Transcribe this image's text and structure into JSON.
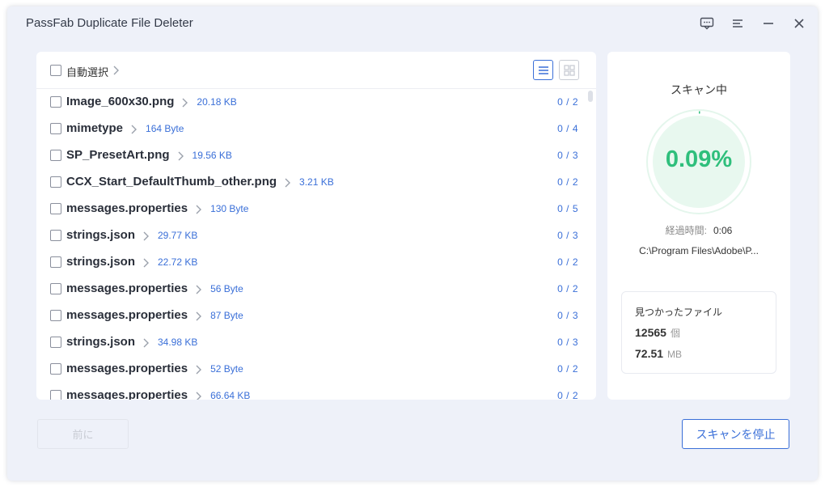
{
  "window": {
    "title": "PassFab Duplicate File Deleter"
  },
  "file_list": {
    "auto_select_label": "自動選択",
    "rows": [
      {
        "name": "Image_600x30.png",
        "size": "20.18 KB",
        "count": "0 / 2"
      },
      {
        "name": "mimetype",
        "size": "164 Byte",
        "count": "0 / 4"
      },
      {
        "name": "SP_PresetArt.png",
        "size": "19.56 KB",
        "count": "0 / 3"
      },
      {
        "name": "CCX_Start_DefaultThumb_other.png",
        "size": "3.21 KB",
        "count": "0 / 2"
      },
      {
        "name": "messages.properties",
        "size": "130 Byte",
        "count": "0 / 5"
      },
      {
        "name": "strings.json",
        "size": "29.77 KB",
        "count": "0 / 3"
      },
      {
        "name": "strings.json",
        "size": "22.72 KB",
        "count": "0 / 2"
      },
      {
        "name": "messages.properties",
        "size": "56 Byte",
        "count": "0 / 2"
      },
      {
        "name": "messages.properties",
        "size": "87 Byte",
        "count": "0 / 3"
      },
      {
        "name": "strings.json",
        "size": "34.98 KB",
        "count": "0 / 3"
      },
      {
        "name": "messages.properties",
        "size": "52 Byte",
        "count": "0 / 2"
      },
      {
        "name": "messages.properties",
        "size": "66.64 KB",
        "count": "0 / 2"
      }
    ]
  },
  "scan": {
    "title": "スキャン中",
    "progress_text": "0.09%",
    "progress_fraction": 0.0009,
    "elapsed_label": "経過時間:",
    "elapsed_value": "0:06",
    "current_path": "C:\\Program Files\\Adobe\\P...",
    "found": {
      "label": "見つかったファイル",
      "count": "12565",
      "count_unit": "個",
      "size": "72.51",
      "size_unit": "MB"
    }
  },
  "buttons": {
    "prev": "前に",
    "stop": "スキャンを停止"
  },
  "colors": {
    "accent": "#3a6fd8",
    "progress": "#2fbf7c",
    "background": "#eef1f9"
  },
  "icons": [
    "feedback-icon",
    "menu-icon",
    "minimize-icon",
    "close-icon",
    "list-view-icon",
    "grid-view-icon",
    "chevron-right-icon"
  ]
}
